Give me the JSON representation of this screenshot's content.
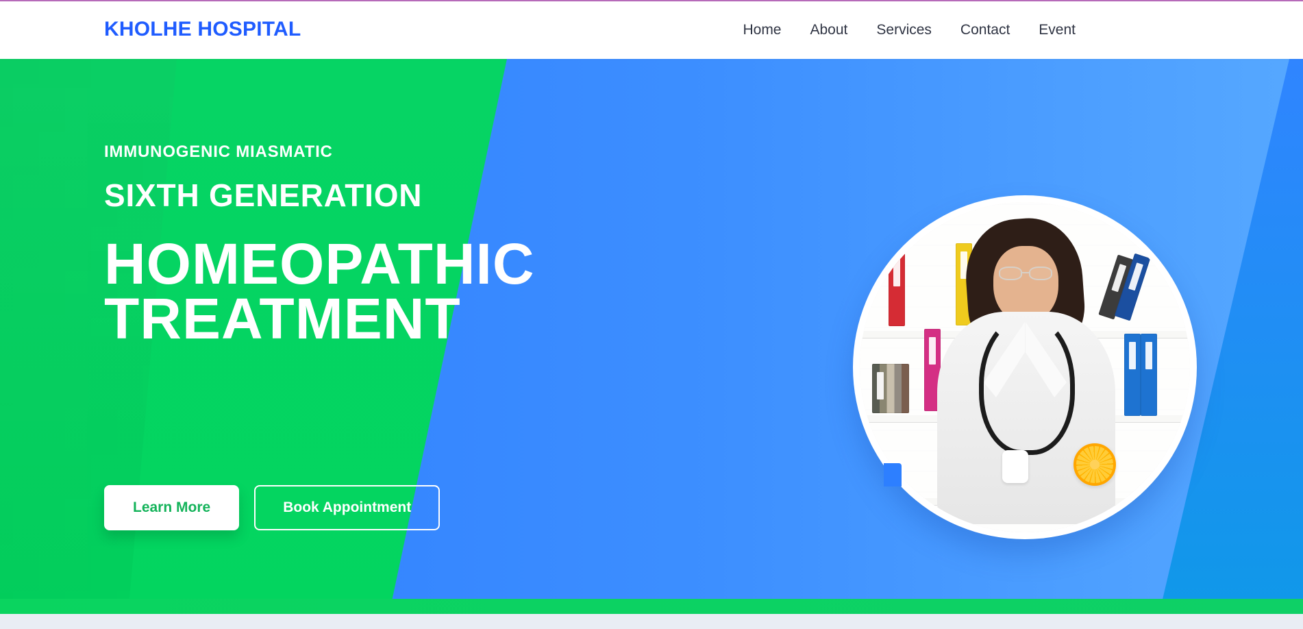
{
  "header": {
    "brand": "KHOLHE HOSPITAL",
    "nav": [
      {
        "label": "Home"
      },
      {
        "label": "About"
      },
      {
        "label": "Services"
      },
      {
        "label": "Contact"
      },
      {
        "label": "Event"
      }
    ]
  },
  "hero": {
    "eyebrow": "IMMUNOGENIC MIASMATIC",
    "subhead": "SIXTH GENERATION",
    "headline": "HOMEOPATHIC\nTREATMENT",
    "actions": {
      "primary_label": "Learn More",
      "secondary_label": "Book Appointment"
    }
  },
  "colors": {
    "brand": "#1f5cff",
    "green": "#03d55f",
    "blue": "#2d7cff",
    "white": "#ffffff",
    "nav_text": "#2f3443"
  },
  "icons": {
    "doctor_portrait": "doctor-portrait",
    "orange": "orange-icon",
    "bottle": "bottle-icon"
  }
}
